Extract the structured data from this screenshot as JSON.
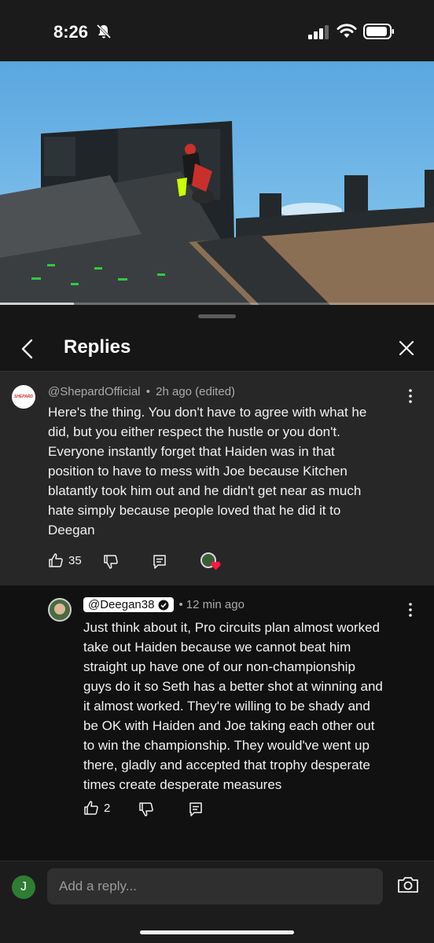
{
  "status_bar": {
    "time": "8:26"
  },
  "video": {
    "progress": 0.17
  },
  "sheet": {
    "title": "Replies"
  },
  "parent_comment": {
    "author": "@ShepardOfficial",
    "separator": "•",
    "time": "2h ago (edited)",
    "avatar_text": "SHEPARD",
    "lines": [
      "Here's the thing. You don't have to agree with what he",
      "did, but you either respect the hustle or you don't.",
      "Everyone instantly forget that Haiden was in that",
      "position to have to mess with Joe because Kitchen",
      "blatantly took him out and he didn't get near as much",
      "hate simply because people loved that he did it to",
      "Deegan"
    ],
    "likes": "35"
  },
  "reply_comment": {
    "author": "@Deegan38",
    "separator": "•",
    "time": "12 min ago",
    "lines": [
      "Just think about it, Pro circuits plan almost worked",
      "take out Haiden because we cannot beat him",
      "straight up have one of our non-championship",
      "guys do it so Seth has a better shot at winning and",
      "it almost worked. They're willing to be shady and",
      "be OK with Haiden and Joe taking each other out",
      "to win the championship. They would've went up",
      "there, gladly and accepted that trophy desperate",
      "times create desperate measures"
    ],
    "likes": "2"
  },
  "composer": {
    "user_initial": "J",
    "placeholder": "Add a reply..."
  }
}
